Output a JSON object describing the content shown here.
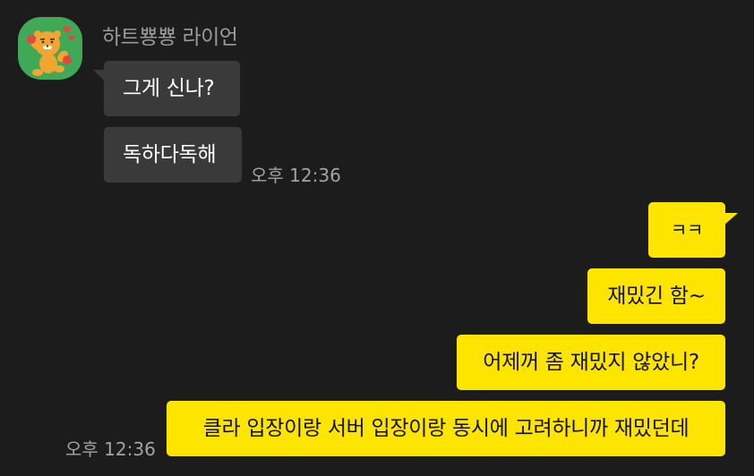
{
  "sender": {
    "name": "하트뿅뿅 라이언",
    "avatar_icon": "lion-character-icon"
  },
  "incoming": [
    {
      "text": "그게 신나?"
    },
    {
      "text": "독하다독해"
    }
  ],
  "incoming_time": "오후 12:36",
  "outgoing": [
    {
      "text": "ㅋㅋ"
    },
    {
      "text": "재밌긴 함~"
    },
    {
      "text": "어제꺼 좀 재밌지 않았니?"
    },
    {
      "text": "클라 입장이랑 서버 입장이랑 동시에 고려하니까 재밌던데"
    }
  ],
  "outgoing_time": "오후 12:36",
  "colors": {
    "background": "#1c1c1c",
    "incoming_bubble": "#3a3a3a",
    "outgoing_bubble": "#fee500",
    "avatar_bg": "#3fa957"
  }
}
